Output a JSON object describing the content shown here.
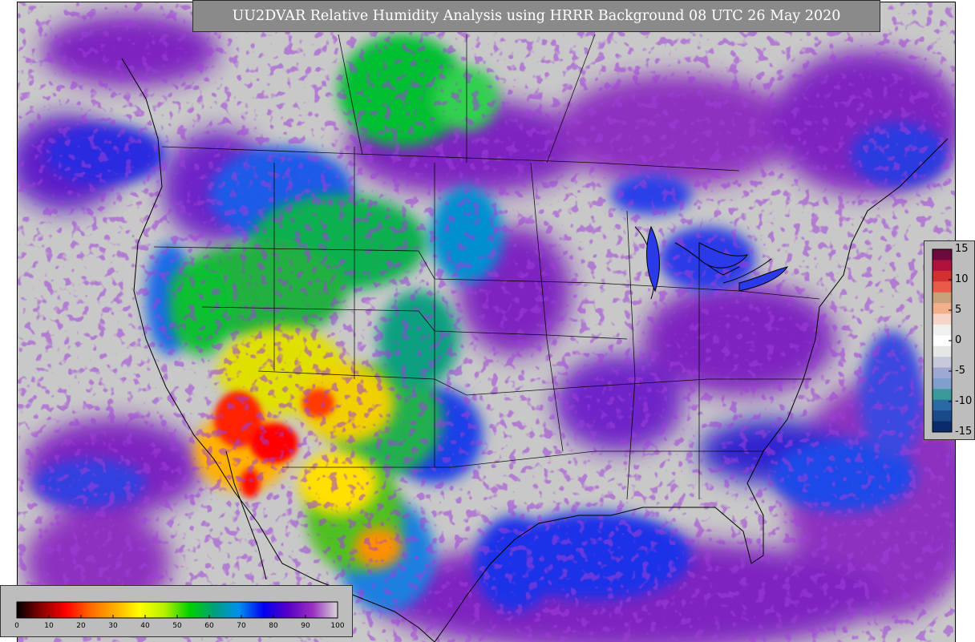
{
  "map": {
    "title": "UU2DVAR Relative Humidity Analysis using HRRR Background 08 UTC 26 May 2020",
    "background_color": "#c8c8c8",
    "icons": [
      "relative-humidity-field",
      "coastline-outline",
      "state-border-lines",
      "great-lakes"
    ]
  },
  "rh_colorbar": {
    "ticks": [
      "0",
      "10",
      "20",
      "30",
      "40",
      "50",
      "60",
      "70",
      "80",
      "90",
      "100"
    ],
    "colors": [
      "#000000",
      "#8b0000",
      "#ff0000",
      "#ff6a00",
      "#ffb000",
      "#ffff00",
      "#b4f000",
      "#00d000",
      "#00a07a",
      "#0090f0",
      "#0000f0",
      "#5a00c8",
      "#9a30c0",
      "#d8d8d8"
    ]
  },
  "diff_colorbar": {
    "ticks": [
      "15",
      "10",
      "5",
      "0",
      "-5",
      "-10",
      "-15"
    ],
    "colors": [
      "#6d0a3c",
      "#b0103c",
      "#d23030",
      "#e85a4a",
      "#c8a07a",
      "#f2b08a",
      "#f5d6c6",
      "#f0f0f0",
      "#ffffff",
      "#e6e6e6",
      "#c8c8dc",
      "#9fa8d0",
      "#7fa0cc",
      "#3a9a9a",
      "#2a6aa4",
      "#1a4a8a",
      "#0a2a6a"
    ]
  }
}
